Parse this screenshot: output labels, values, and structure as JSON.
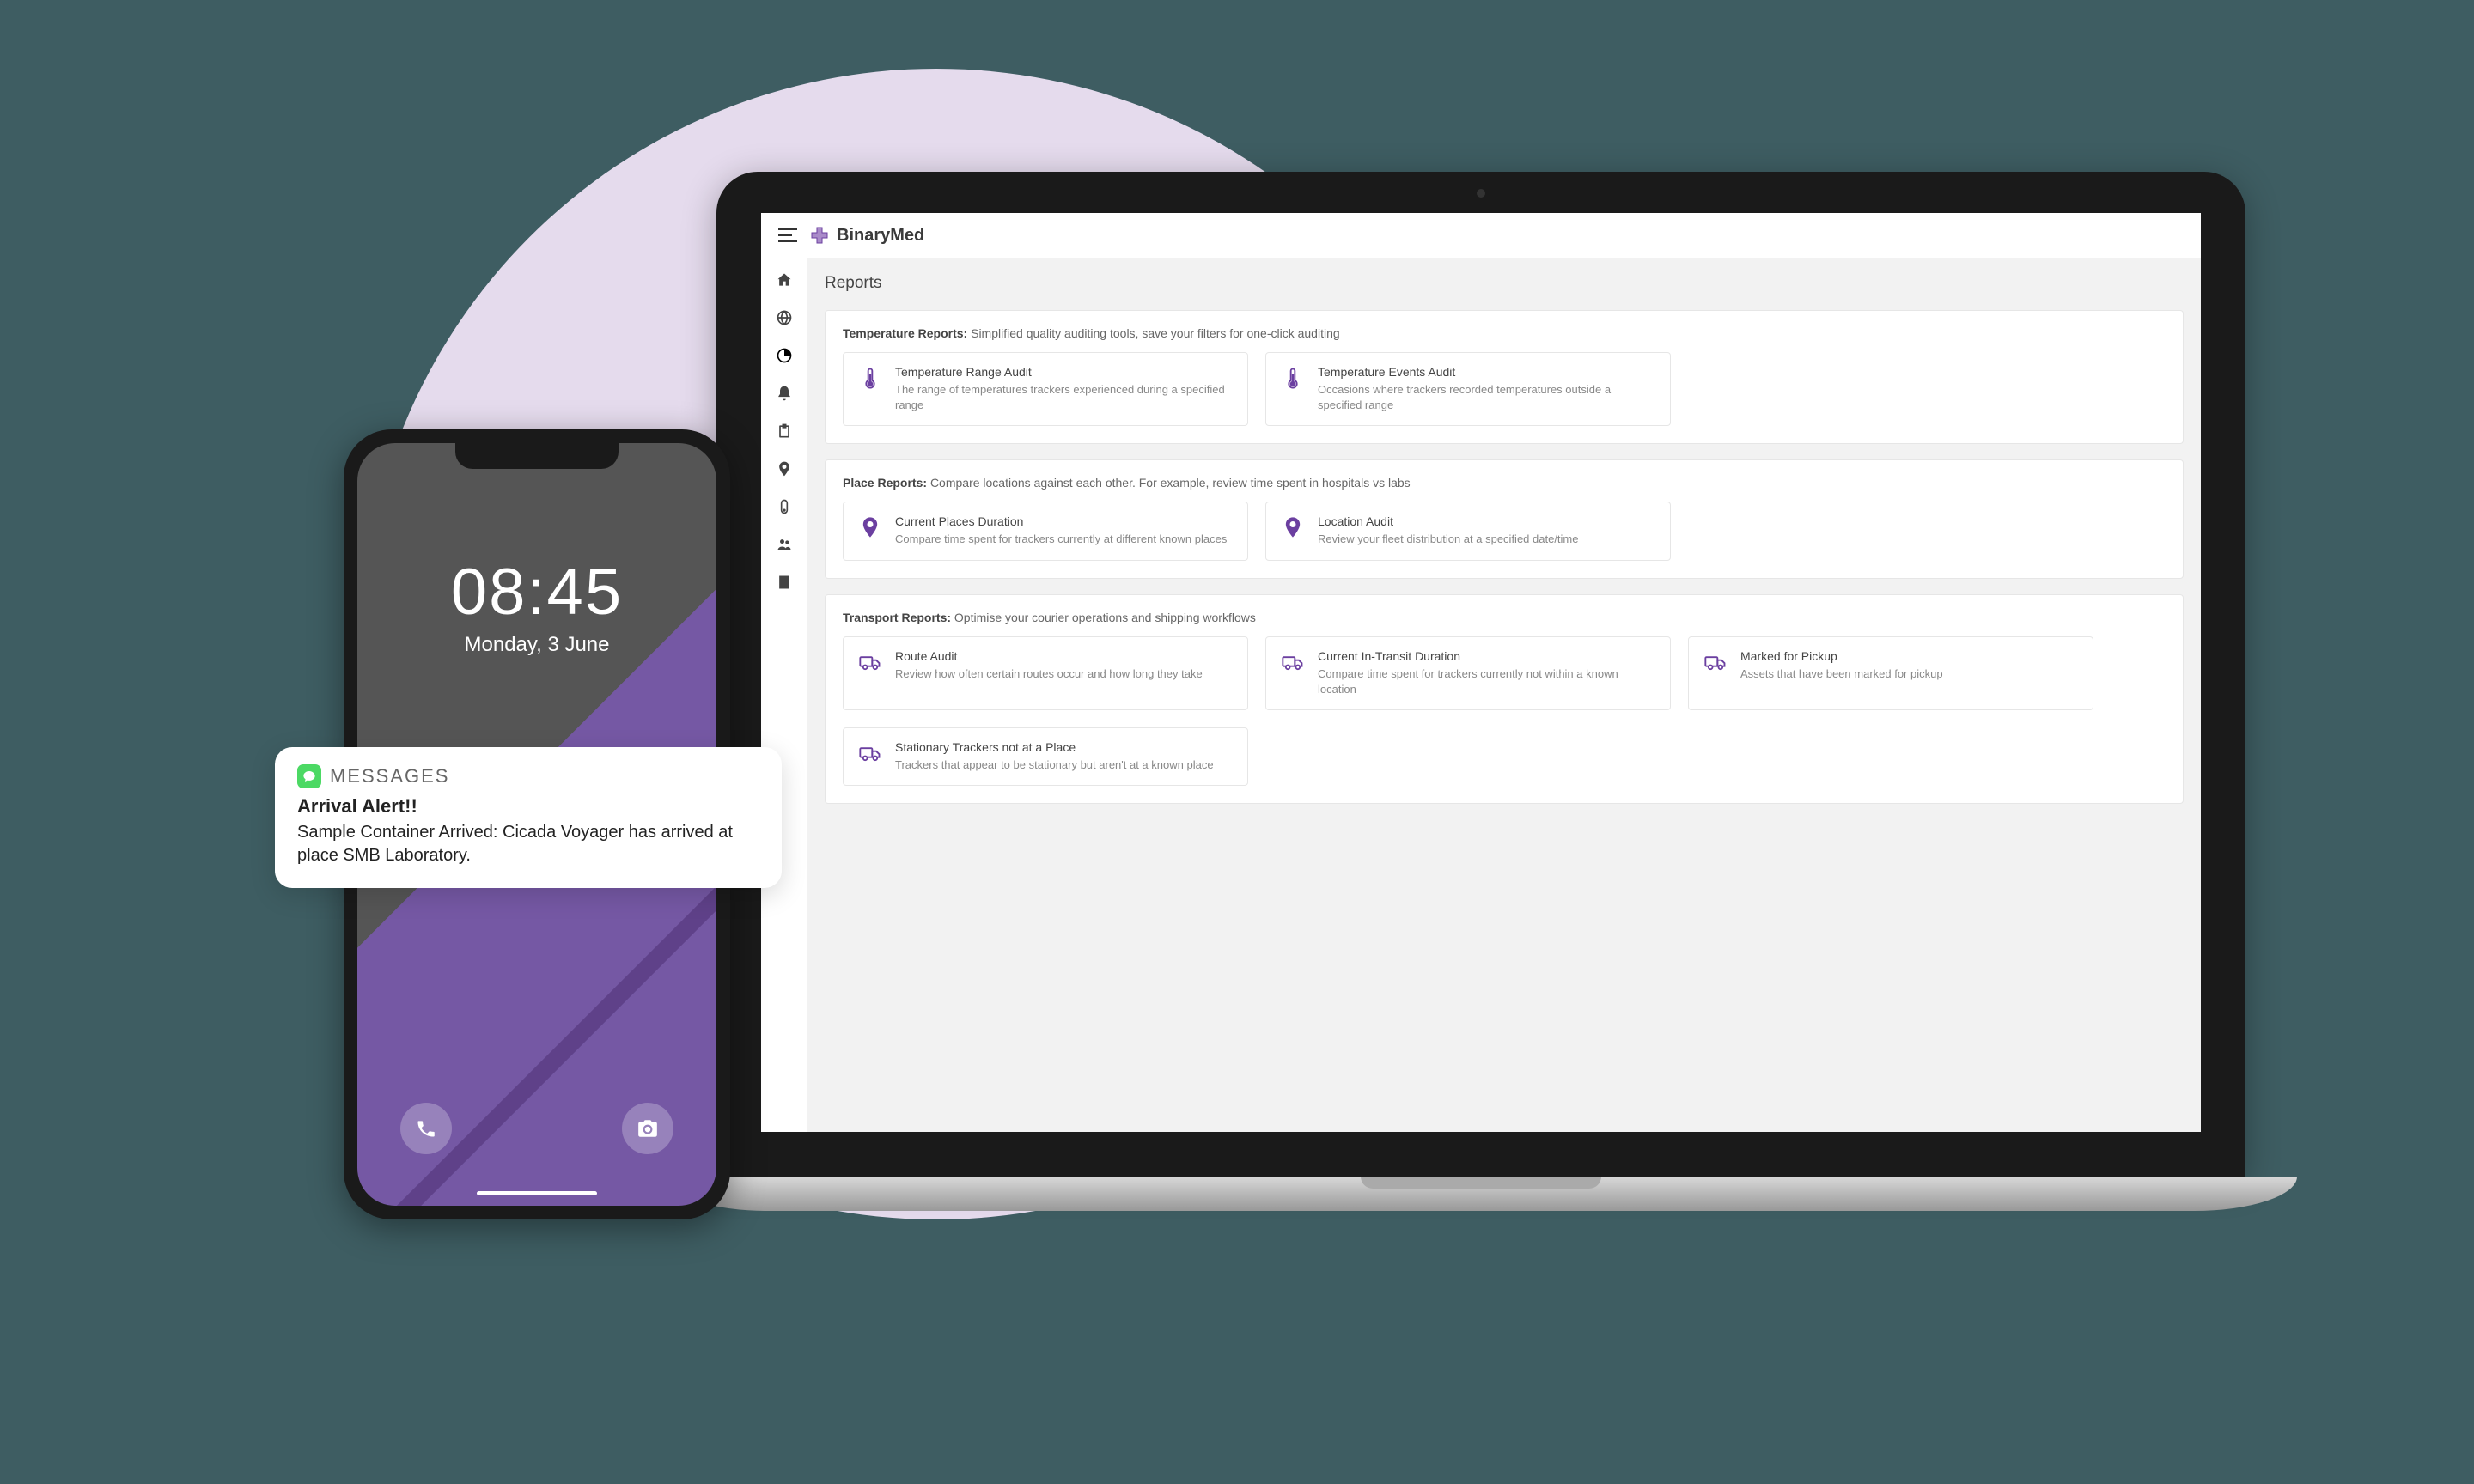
{
  "app": {
    "brand": "BinaryMed",
    "page_title": "Reports"
  },
  "sections": [
    {
      "label": "Temperature Reports:",
      "sub": "Simplified quality auditing tools, save your filters for one-click auditing",
      "icon": "thermometer",
      "cards": [
        {
          "title": "Temperature Range Audit",
          "desc": "The range of temperatures trackers experienced during a specified range"
        },
        {
          "title": "Temperature Events Audit",
          "desc": "Occasions where trackers recorded temperatures outside a specified range"
        }
      ]
    },
    {
      "label": "Place Reports:",
      "sub": "Compare locations against each other. For example, review time spent in hospitals vs labs",
      "icon": "pin",
      "cards": [
        {
          "title": "Current Places Duration",
          "desc": "Compare time spent for trackers currently at different known places"
        },
        {
          "title": "Location Audit",
          "desc": "Review your fleet distribution at a specified date/time"
        }
      ]
    },
    {
      "label": "Transport Reports:",
      "sub": "Optimise your courier operations and shipping workflows",
      "icon": "truck",
      "cards": [
        {
          "title": "Route Audit",
          "desc": "Review how often certain routes occur and how long they take"
        },
        {
          "title": "Current In-Transit Duration",
          "desc": "Compare time spent for trackers currently not within a known location"
        },
        {
          "title": "Marked for Pickup",
          "desc": "Assets that have been marked for pickup"
        },
        {
          "title": "Stationary Trackers not at a Place",
          "desc": "Trackers that appear to be stationary but aren't at a known place"
        }
      ]
    }
  ],
  "phone": {
    "time": "08:45",
    "date": "Monday, 3 June"
  },
  "notification": {
    "app_label": "MESSAGES",
    "title": "Arrival Alert!!",
    "body": "Sample Container Arrived: Cicada Voyager has arrived at place SMB Laboratory."
  }
}
